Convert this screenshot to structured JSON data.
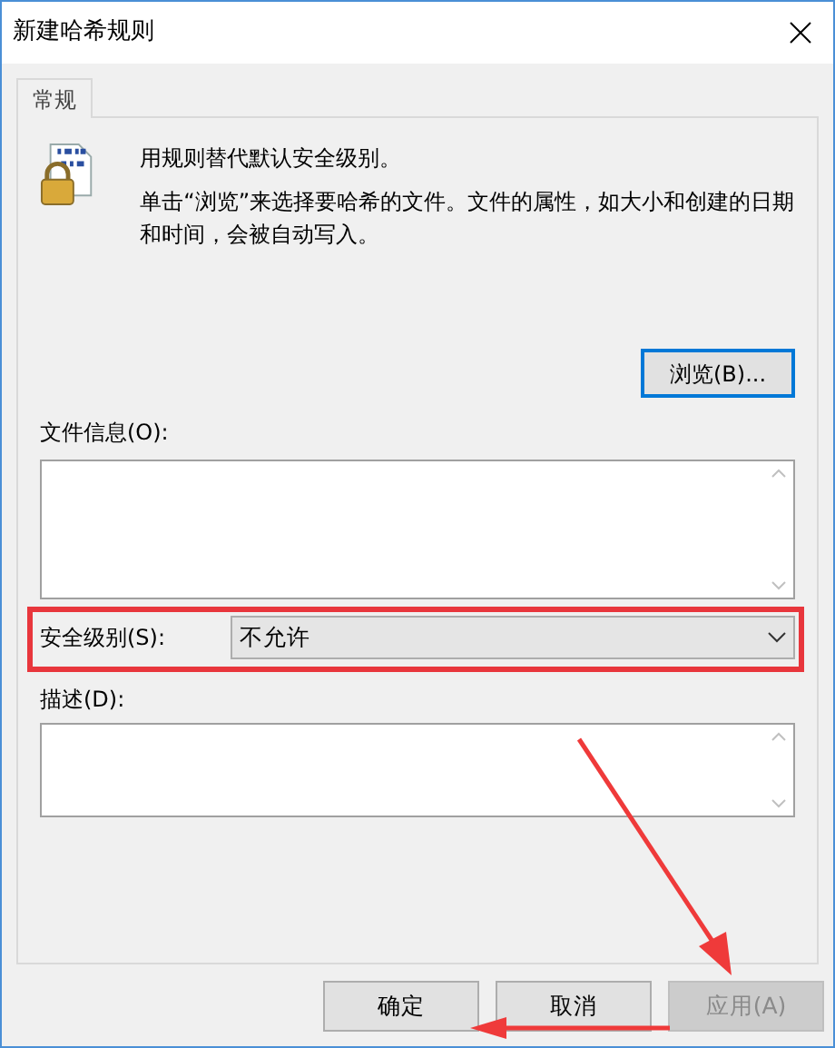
{
  "window": {
    "title": "新建哈希规则"
  },
  "tabs": [
    {
      "label": "常规",
      "selected": true
    }
  ],
  "intro": {
    "heading": "用规则替代默认安全级别。",
    "body": "单击“浏览”来选择要哈希的文件。文件的属性，如大小和创建的日期和时间，会被自动写入。"
  },
  "browse_button": "浏览(B)...",
  "file_info": {
    "label": "文件信息(O):"
  },
  "security_level": {
    "label": "安全级别(S):",
    "value": "不允许"
  },
  "description": {
    "label": "描述(D):"
  },
  "buttons": [
    {
      "label": "确定",
      "disabled": false
    },
    {
      "label": "取消",
      "disabled": false
    },
    {
      "label": "应用(A)",
      "disabled": true
    }
  ]
}
